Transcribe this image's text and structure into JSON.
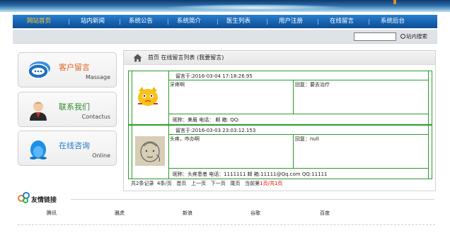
{
  "nav": {
    "items": [
      "网站首页",
      "站内新闻",
      "系统公告",
      "系统简介",
      "医生列表",
      "用户注册",
      "在线留言",
      "系统后台"
    ],
    "separator": "|",
    "active_color": "#ffcc33"
  },
  "search": {
    "button_label": "站内搜索",
    "value": ""
  },
  "cards": [
    {
      "title": "客户留言",
      "subtitle": "Massage",
      "title_color": "#e0601a",
      "icon": "chat-bubbles-icon"
    },
    {
      "title": "联系我们",
      "subtitle": "Contactus",
      "title_color": "#2e8b2e",
      "icon": "person-icon"
    },
    {
      "title": "在线咨询",
      "subtitle": "Online",
      "title_color": "#1f78c8",
      "icon": "qq-penguin-icon"
    }
  ],
  "breadcrumb": {
    "text": "首页 在线留言列表 (我要留言)"
  },
  "messages": [
    {
      "time": "留言于:2016-03-04 17:18:26.95",
      "content": "牙疼啊",
      "reply": "回复：要去治疗",
      "info": "昵称：美眉    电话：  邮 箱:   QQ:",
      "avatar": "cartoon-cat-avatar"
    },
    {
      "time": "留言于:2016-03-03 23:03:12.153",
      "content": "头疼，咋办啊",
      "reply": "回复：null",
      "info": "昵称：头疼患者    电话：1111111  邮 箱:11111@Qq.com    QQ:11111",
      "avatar": "sketch-face-avatar"
    }
  ],
  "pager": {
    "total": "共2条记录",
    "per_page": "4条/页",
    "first": "首页",
    "prev": "上一页",
    "next": "下一页",
    "last": "尾页",
    "current_label": "当前第",
    "current_value": "1页/共1页"
  },
  "links": {
    "title": "友情链接",
    "items": [
      "腾讯",
      "雅虎",
      "新浪",
      "谷歌",
      "百度"
    ]
  },
  "colors": {
    "table_border": "#2c9a2c",
    "nav_bg": "#1660ad"
  }
}
